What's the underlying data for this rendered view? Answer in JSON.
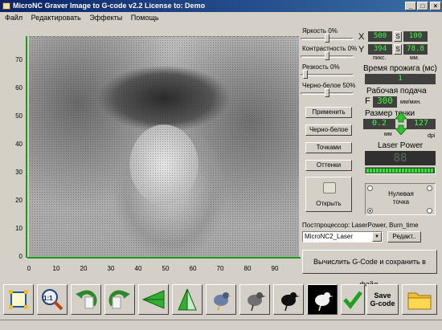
{
  "window": {
    "title": "MicroNC Graver Image to G-code v2.2 License to: Demo",
    "minimize": "_",
    "maximize": "□",
    "close": "×"
  },
  "menu": [
    "Файл",
    "Редактировать",
    "Эффекты",
    "Помощь"
  ],
  "axes": {
    "y_ticks": [
      "70",
      "60",
      "50",
      "40",
      "30",
      "20",
      "10",
      "0"
    ],
    "x_ticks": [
      "0",
      "10",
      "20",
      "30",
      "40",
      "50",
      "60",
      "70",
      "80",
      "90"
    ]
  },
  "panel": {
    "brightness_label": "Яркость 0%",
    "contrast_label": "Контрастность 0%",
    "sharpness_label": "Резкость 0%",
    "bw_label": "Черно-белое 50%",
    "sliders": {
      "brightness": 0.5,
      "contrast": 0.5,
      "sharpness": 0.05,
      "bw": 0.5
    },
    "x_label": "X",
    "y_label": "Y",
    "width_px": "500",
    "height_px": "394",
    "width_mm": "100",
    "height_mm": "78.8",
    "s_label": "S",
    "px_unit": "пикс.",
    "mm_unit": "мм.",
    "burn_time_label": "Время прожига (мс)",
    "burn_time_value": "1",
    "feed_label": "Рабочая подача",
    "feed_f": "F",
    "feed_value": "300",
    "feed_unit": "мм/мин.",
    "dot_size_label": "Размер точки",
    "dot_size_value": "0.2",
    "dpi_value": "127",
    "mm_short": "мм",
    "dpi_unit": "dpi",
    "laser_power_label": "Laser Power",
    "laser_power_value": "88",
    "laser_power_level": 1.0,
    "apply_button": "Применить",
    "bw_button": "Черно-белое",
    "dots_button": "Точками",
    "shades_button": "Оттенки",
    "open_button": "Открыть",
    "zero_point_label": "Нулевая точка",
    "postprocessor_label": "Постпроцессор: LaserPower, Burn_time",
    "postprocessor_value": "MicroNC2_Laser",
    "edit_button": "Редакт..",
    "compute_button": "Вычислить G-Code и сохранить в файл."
  },
  "toolbar": {
    "zoom_label": "1:1",
    "save_gcode_line1": "Save",
    "save_gcode_line2": "G-code"
  },
  "colors": {
    "accent": "#1a9a1a",
    "lcd_bg": "#404040",
    "lcd_fg": "#3cff3c",
    "title_bg": "#0a246a"
  }
}
